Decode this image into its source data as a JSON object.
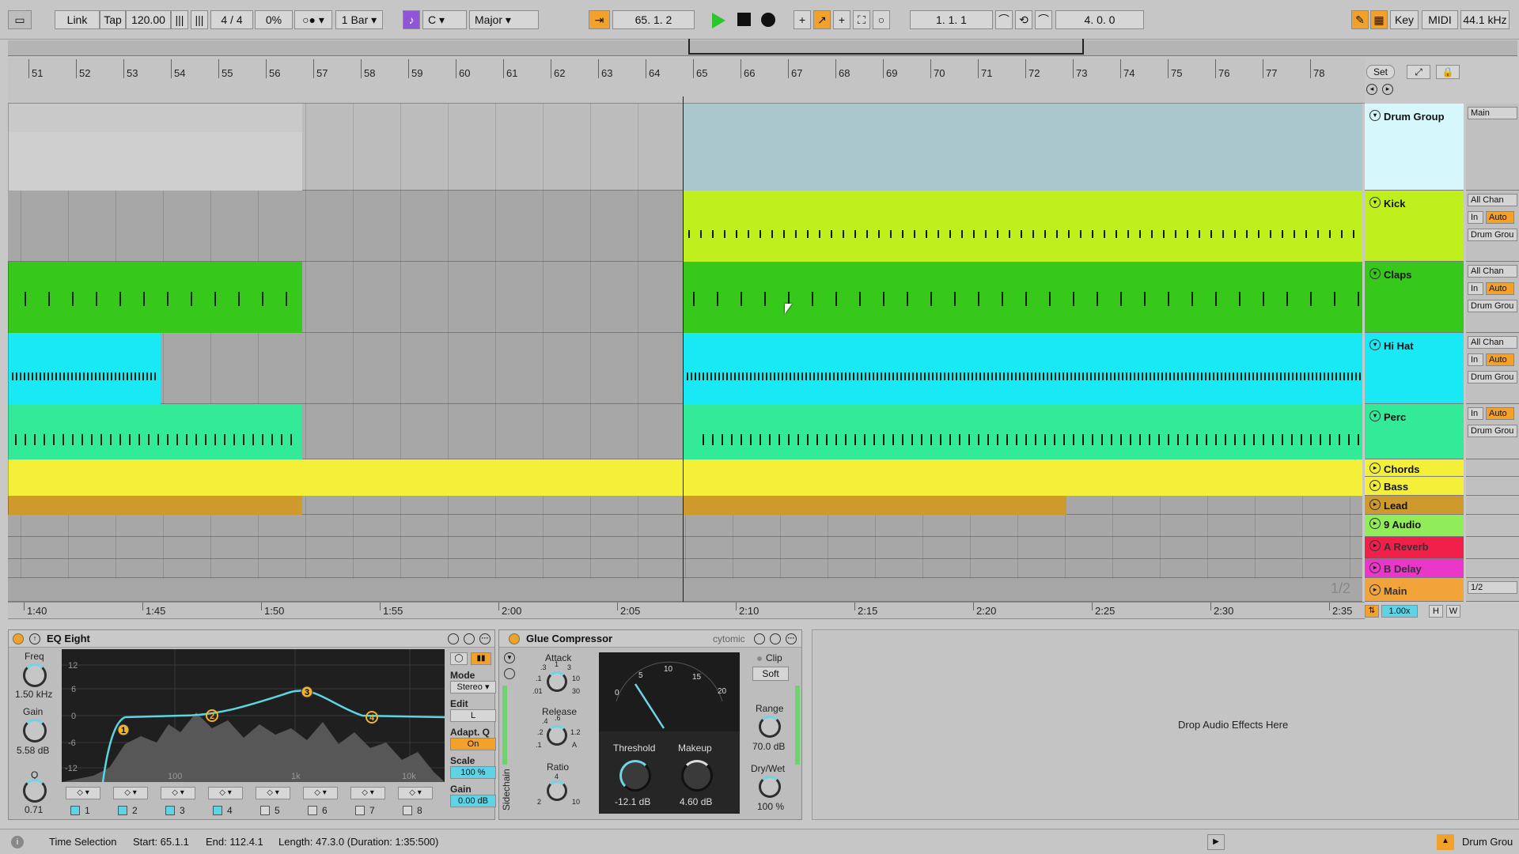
{
  "transport": {
    "link": "Link",
    "tap": "Tap",
    "tempo": "120.00",
    "signature": "4 / 4",
    "swing": "0%",
    "quant": "1 Bar",
    "key": "C",
    "scale": "Major",
    "position": "65.  1.  2",
    "loop_start": "1.  1.  1",
    "loop_length": "4.  0.  0",
    "key_label": "Key",
    "midi_label": "MIDI",
    "sample_rate": "44.1 kHz"
  },
  "ruler": {
    "bars": [
      "51",
      "52",
      "53",
      "54",
      "55",
      "56",
      "57",
      "58",
      "59",
      "60",
      "61",
      "62",
      "63",
      "64",
      "65",
      "66",
      "67",
      "68",
      "69",
      "70",
      "71",
      "72",
      "73",
      "74",
      "75",
      "76",
      "77",
      "78"
    ],
    "set_label": "Set"
  },
  "timeline": {
    "labels": [
      "1:40",
      "1:45",
      "1:50",
      "1:55",
      "2:00",
      "2:05",
      "2:10",
      "2:15",
      "2:20",
      "2:25",
      "2:30",
      "2:35"
    ],
    "page": "1/2",
    "zoom": "1.00x",
    "h": "H",
    "w": "W"
  },
  "tracks": [
    {
      "name": "Drum Group",
      "color": "#cdf3f8",
      "routing": "Main"
    },
    {
      "name": "Kick",
      "color": "#bff01e",
      "routing": "All Chan",
      "monitor_in": "In",
      "monitor_auto": "Auto",
      "output": "Drum Grou"
    },
    {
      "name": "Claps",
      "color": "#36c91b",
      "routing": "All Chan",
      "monitor_in": "In",
      "monitor_auto": "Auto",
      "output": "Drum Grou"
    },
    {
      "name": "Hi Hat",
      "color": "#19e9f5",
      "routing": "All Chan",
      "monitor_in": "In",
      "monitor_auto": "Auto",
      "output": "Drum Grou"
    },
    {
      "name": "Perc",
      "color": "#33ea99",
      "monitor_in": "In",
      "monitor_auto": "Auto",
      "output": "Drum Grou"
    },
    {
      "name": "Chords",
      "color": "#f4f03a"
    },
    {
      "name": "Bass",
      "color": "#f4f03a"
    },
    {
      "name": "Lead",
      "color": "#cf9a2c"
    },
    {
      "name": "9 Audio",
      "color": "#91ec5a"
    },
    {
      "name": "A Reverb",
      "color": "#f0204b"
    },
    {
      "name": "B Delay",
      "color": "#ea37c9"
    },
    {
      "name": "Main",
      "color": "#f2a43a",
      "routing": "1/2"
    }
  ],
  "eq": {
    "title": "EQ Eight",
    "freq_label": "Freq",
    "freq": "1.50 kHz",
    "gain_label": "Gain",
    "gain": "5.58 dB",
    "q_label": "Q",
    "q": "0.71",
    "db_ticks": [
      "12",
      "6",
      "0",
      "-6",
      "-12"
    ],
    "freq_ticks": [
      "100",
      "1k",
      "10k"
    ],
    "mode_label": "Mode",
    "mode": "Stereo",
    "edit_label": "Edit",
    "edit": "L",
    "adaptq_label": "Adapt. Q",
    "adaptq": "On",
    "scale_label": "Scale",
    "scale": "100 %",
    "outgain_label": "Gain",
    "outgain": "0.00 dB",
    "bands": [
      "1",
      "2",
      "3",
      "4",
      "5",
      "6",
      "7",
      "8"
    ],
    "points": [
      "1",
      "2",
      "3",
      "4"
    ]
  },
  "glue": {
    "title": "Glue Compressor",
    "brand": "cytomic",
    "attack_label": "Attack",
    "attack_ticks": [
      ".3",
      "1",
      "3",
      ".1",
      "10",
      ".01",
      "30"
    ],
    "release_label": "Release",
    "release_ticks": [
      ".4",
      ".6",
      ".2",
      "1.2",
      ".1",
      "A"
    ],
    "ratio_label": "Ratio",
    "ratio_ticks": [
      "4",
      "2",
      "10"
    ],
    "meter_ticks": [
      "0",
      "5",
      "10",
      "15",
      "20"
    ],
    "threshold_label": "Threshold",
    "threshold": "-12.1 dB",
    "makeup_label": "Makeup",
    "makeup": "4.60 dB",
    "clip_label": "Clip",
    "clip_mode": "Soft",
    "range_label": "Range",
    "range": "70.0 dB",
    "drywet_label": "Dry/Wet",
    "drywet": "100 %",
    "sidechain": "Sidechain"
  },
  "drop_text": "Drop Audio Effects Here",
  "status": {
    "mode": "Time Selection",
    "start": "Start: 65.1.1",
    "end": "End: 112.4.1",
    "length": "Length: 47.3.0 (Duration: 1:35:500)",
    "track": "Drum Grou"
  }
}
